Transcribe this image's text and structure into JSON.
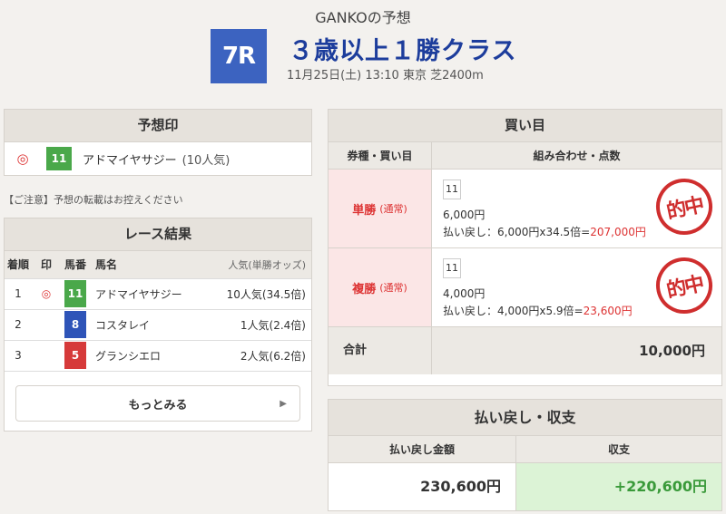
{
  "header": {
    "title": "GANKOの予想",
    "race_number": "7R",
    "race_name": "３歳以上１勝クラス",
    "race_info": "11月25日(土) 13:10 東京 芝2400m"
  },
  "prediction": {
    "heading": "予想印",
    "mark": "◎",
    "horse_number": "11",
    "horse_name": "アドマイヤサジー",
    "popularity": "(10人気)"
  },
  "notice": "【ご注意】予想の転載はお控えください",
  "results": {
    "heading": "レース結果",
    "columns": [
      "着順",
      "印",
      "馬番",
      "馬名",
      "人気(単勝オッズ)"
    ],
    "rows": [
      {
        "rank": "1",
        "mark": "◎",
        "number": "11",
        "name": "アドマイヤサジー",
        "odds": "10人気(34.5倍)",
        "color": "#4aa84a"
      },
      {
        "rank": "2",
        "mark": "",
        "number": "8",
        "name": "コスタレイ",
        "odds": "1人気(2.4倍)",
        "color": "#2e54b8"
      },
      {
        "rank": "3",
        "mark": "",
        "number": "5",
        "name": "グランシエロ",
        "odds": "2人気(6.2倍)",
        "color": "#d63a3a"
      }
    ],
    "more_label": "もっとみる"
  },
  "bets": {
    "heading": "買い目",
    "col_type": "券種・買い目",
    "col_combo": "組み合わせ・点数",
    "rows": [
      {
        "type": "単勝",
        "sub": "(通常)",
        "combo": "11",
        "amount": "6,000円",
        "payout_prefix": "払い戻し：6,000円x34.5倍=",
        "payout_value": "207,000円",
        "stamp": "的中"
      },
      {
        "type": "複勝",
        "sub": "(通常)",
        "combo": "11",
        "amount": "4,000円",
        "payout_prefix": "払い戻し：4,000円x5.9倍=",
        "payout_value": "23,600円",
        "stamp": "的中"
      }
    ],
    "total_label": "合計",
    "total_value": "10,000円"
  },
  "balance": {
    "heading": "払い戻し・収支",
    "col_payout": "払い戻し金額",
    "col_profit": "収支",
    "payout": "230,600円",
    "profit": "+220,600円"
  },
  "colors": {
    "accent": "#3c63c0",
    "profit_bg": "#dcf3d6",
    "profit_text": "#3a9a3a",
    "payout_red": "#d33"
  }
}
